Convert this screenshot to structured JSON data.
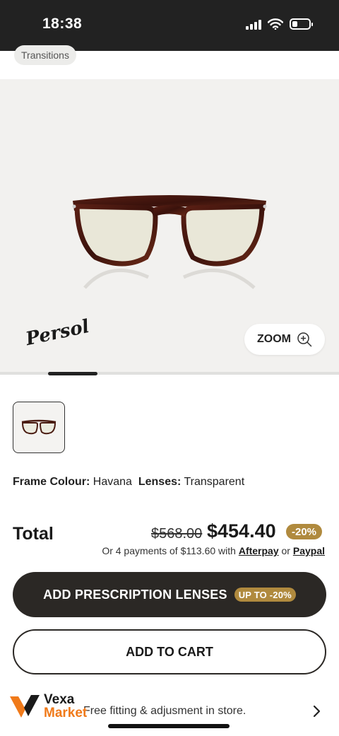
{
  "status_bar": {
    "time": "18:38",
    "battery_level": 0.3
  },
  "chip": {
    "label": "Transitions"
  },
  "product_image": {
    "brand_logo": "Persol",
    "zoom_label": "ZOOM",
    "icon": "zoom-in-icon"
  },
  "frame_details": {
    "frame_colour_label": "Frame Colour:",
    "frame_colour_value": "Havana",
    "lenses_label": "Lenses:",
    "lenses_value": "Transparent"
  },
  "pricing": {
    "total_label": "Total",
    "original_price": "$568.00",
    "sale_price": "$454.40",
    "discount": "-20%",
    "installments_prefix": "Or 4 payments of $113.60 with",
    "afterpay": "Afterpay",
    "or": "or",
    "paypal": "Paypal"
  },
  "actions": {
    "add_prescription_label": "ADD PRESCRIPTION LENSES",
    "add_prescription_badge": "UP TO -20%",
    "add_to_cart_label": "ADD TO CART"
  },
  "fitting": {
    "text": "Free fitting & adjusment in store.",
    "icon": "chevron-right-icon"
  },
  "watermark": {
    "top": "Vexa",
    "bottom": "Market"
  },
  "colors": {
    "dark": "#2b2825",
    "gold_badge": "#b08a3e",
    "status_bar": "#222222",
    "brand_orange": "#f07a1a"
  }
}
